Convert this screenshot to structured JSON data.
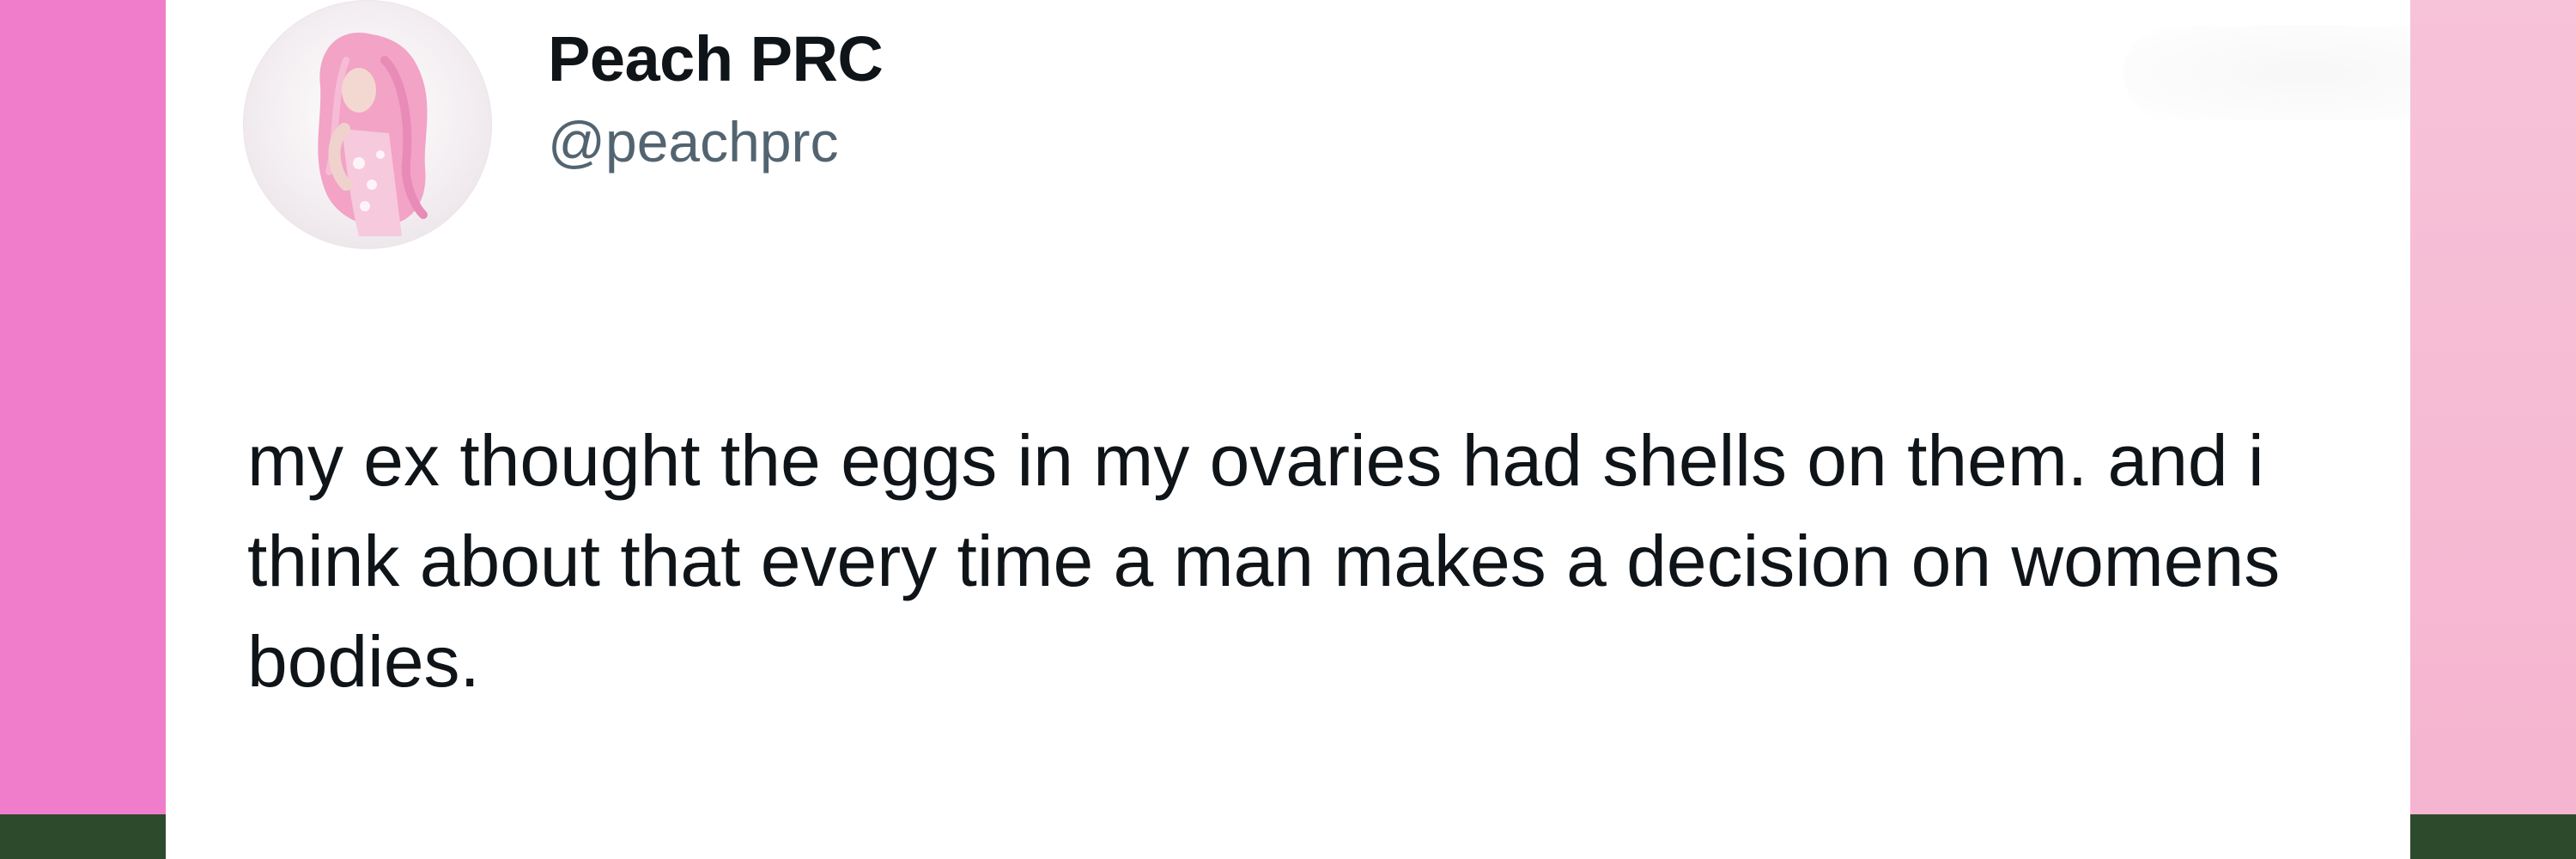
{
  "theme": {
    "left_panel": "#ef7dcc",
    "right_panel": "#f7c3d8",
    "floor": "#2e4a2c",
    "card_background": "#ffffff",
    "name_color": "#0f1419",
    "handle_color": "#536471",
    "text_color": "#0f1419"
  },
  "tweet": {
    "author": {
      "display_name": "Peach PRC",
      "handle": "@peachprc",
      "avatar_icon": "profile-photo"
    },
    "text": "my ex thought the eggs in my ovaries had shells on them. and i think about that every time a man makes a decision on womens bodies."
  }
}
